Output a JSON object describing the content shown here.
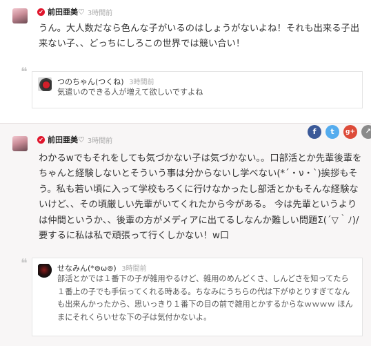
{
  "posts": [
    {
      "author": "前田亜美♡",
      "time": "3時間前",
      "text": "うん。大人数だなら色んな子がいるのはしょうがないよね！それも出来る子出来ない子、、どっちにしろこの世界では競い合い！",
      "reply": {
        "author": "つのちゃん(つくね)",
        "time": "3時間前",
        "text": "気遣いのできる人が増えて欲しいですよね"
      }
    },
    {
      "author": "前田亜美♡",
      "time": "3時間前",
      "text": "わかるwでもそれをしても気づかない子は気づかない。。口部活とか先輩後輩をちゃんと経験しないとそういう事は分からないし学べない(*´・ν・`)挨拶もそう。私も若い頃に入って学校もろくに行けなかったし部活とかもそんな経験ないけど、、その頃厳しい先輩がいてくれたから今がある。 今は先輩というよりは仲間というか、、後輩の方がメディアに出てるしなんか難しい問題Σ(´▽｀ﾉ)/要するに私は私で頑張って行くしかない！w口",
      "reply": {
        "author": "せなみん(*⊚ω⊚)",
        "time": "3時間前",
        "text": "部活とかでは１番下の子が雑用やるけど、雑用のめんどくさ、しんどさを知ってたら１番上の子でも手伝ってくれる時ある。ちなみにうちらの代は下がゆとりすぎてなんも出来んかったから、思いっきり１番下の目の前で雑用とかするからなｗｗｗｗ ほんまにそれくらいせな下の子は気付かないよ。"
      }
    }
  ],
  "share": {
    "facebook": "f",
    "twitter": "t",
    "googleplus": "g+",
    "external": "↗"
  },
  "icons": {
    "verified": "check-badge-icon",
    "quote": "quote-icon"
  },
  "quote_mark": "❝",
  "verified_glyph": "✔",
  "colors": {
    "verified": "#e0152c",
    "facebook": "#3b5998",
    "twitter": "#55acee",
    "googleplus": "#dd4b39"
  }
}
